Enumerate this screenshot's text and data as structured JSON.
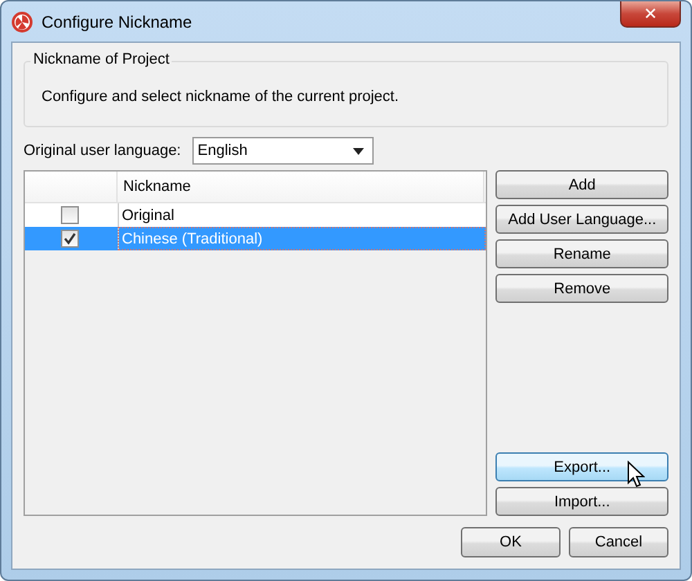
{
  "window": {
    "title": "Configure Nickname",
    "close": "✕"
  },
  "group": {
    "title": "Nickname of Project",
    "description": "Configure and select nickname of the current project."
  },
  "language": {
    "label": "Original user language:",
    "value": "English"
  },
  "table": {
    "columns": [
      "Nickname"
    ],
    "rows": [
      {
        "checked": false,
        "nickname": "Original",
        "selected": false
      },
      {
        "checked": true,
        "nickname": "Chinese (Traditional)",
        "selected": true
      }
    ]
  },
  "side_buttons": [
    {
      "label": "Add",
      "hovered": false
    },
    {
      "label": "Add User Language...",
      "hovered": false
    },
    {
      "label": "Rename",
      "hovered": false
    },
    {
      "label": "Remove",
      "hovered": false
    }
  ],
  "transfer_buttons": [
    {
      "label": "Export...",
      "hovered": true
    },
    {
      "label": "Import...",
      "hovered": false
    }
  ],
  "buttons": [
    "OK",
    "Cancel"
  ]
}
